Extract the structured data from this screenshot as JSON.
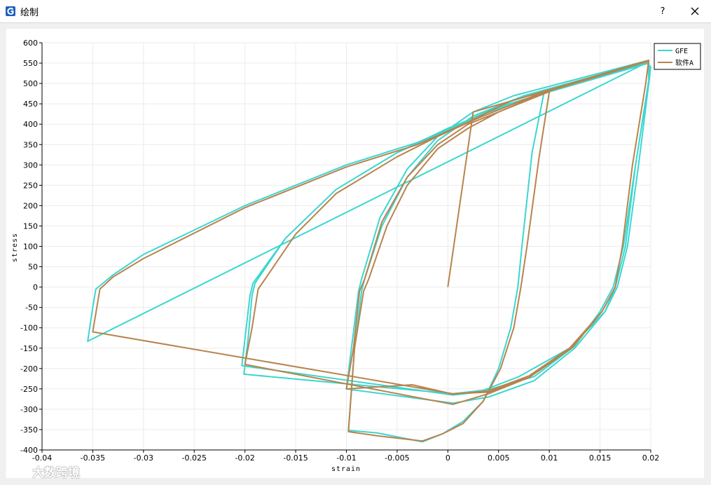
{
  "window": {
    "title": "绘制",
    "help_label": "?",
    "app_icon": "gfe-logo-icon",
    "close_icon": "close-icon"
  },
  "watermark": {
    "text": "大数跨境",
    "icon": "paw-logo-icon"
  },
  "colors": {
    "gfe": "#3cd6d0",
    "software_a": "#b9834d",
    "grid": "#ebebeb"
  },
  "chart_data": {
    "type": "line",
    "xlabel": "strain",
    "ylabel": "stress",
    "xlim": [
      -0.04,
      0.02
    ],
    "ylim": [
      -400,
      600
    ],
    "grid": true,
    "legend_position": "top-right",
    "x_ticks": [
      -0.04,
      -0.035,
      -0.03,
      -0.025,
      -0.02,
      -0.015,
      -0.01,
      -0.005,
      0,
      0.005,
      0.01,
      0.015,
      0.02
    ],
    "y_ticks": [
      600,
      550,
      500,
      450,
      400,
      350,
      300,
      250,
      200,
      150,
      100,
      50,
      0,
      -50,
      -100,
      -150,
      -200,
      -250,
      -300,
      -350,
      -400
    ],
    "x_tick_labels": [
      "-0.04",
      "-0.035",
      "-0.03",
      "-0.025",
      "-0.02",
      "-0.015",
      "-0.01",
      "-0.005",
      "0",
      "0.005",
      "0.01",
      "0.015",
      "0.02"
    ],
    "y_tick_labels": [
      "600",
      "550",
      "500",
      "450",
      "400",
      "350",
      "300",
      "250",
      "200",
      "150",
      "100",
      "50",
      "0",
      "-50",
      "-100",
      "-150",
      "-200",
      "-250",
      "-300",
      "-350",
      "-400"
    ],
    "series": [
      {
        "name": "GFE",
        "color": "#3cd6d0",
        "points": [
          [
            0.0095,
            480
          ],
          [
            0.0083,
            330
          ],
          [
            0.0073,
            100
          ],
          [
            0.0069,
            0
          ],
          [
            0.0062,
            -100
          ],
          [
            0.005,
            -200
          ],
          [
            0.0035,
            -280
          ],
          [
            0.0015,
            -330
          ],
          [
            -0.0005,
            -360
          ],
          [
            -0.0025,
            -380
          ],
          [
            -0.007,
            -358
          ],
          [
            -0.0098,
            -352
          ],
          [
            -0.0092,
            -150
          ],
          [
            -0.0085,
            -10
          ],
          [
            -0.0082,
            20
          ],
          [
            -0.0065,
            150
          ],
          [
            -0.004,
            270
          ],
          [
            -0.001,
            360
          ],
          [
            0.0025,
            420
          ],
          [
            0.007,
            465
          ],
          [
            0.0198,
            550
          ],
          [
            0.0198,
            505
          ],
          [
            0.0185,
            300
          ],
          [
            0.0175,
            100
          ],
          [
            0.0165,
            0
          ],
          [
            0.0155,
            -60
          ],
          [
            0.0125,
            -150
          ],
          [
            0.0085,
            -230
          ],
          [
            0.004,
            -270
          ],
          [
            0.0005,
            -285
          ],
          [
            -0.01,
            -250
          ],
          [
            -0.0095,
            -150
          ],
          [
            -0.0088,
            -10
          ],
          [
            -0.0085,
            20
          ],
          [
            -0.0067,
            170
          ],
          [
            -0.004,
            290
          ],
          [
            -0.001,
            370
          ],
          [
            0.0025,
            430
          ],
          [
            0.0065,
            470
          ],
          [
            0.0195,
            555
          ],
          [
            0.02,
            540
          ],
          [
            0.0185,
            300
          ],
          [
            0.0173,
            100
          ],
          [
            0.0163,
            0
          ],
          [
            0.015,
            -60
          ],
          [
            0.0125,
            -145
          ],
          [
            0.0085,
            -220
          ],
          [
            0.004,
            -252
          ],
          [
            0.0005,
            -262
          ],
          [
            -0.0201,
            -214
          ],
          [
            -0.0197,
            -130
          ],
          [
            -0.0193,
            -20
          ],
          [
            -0.019,
            10
          ],
          [
            -0.016,
            120
          ],
          [
            -0.011,
            240
          ],
          [
            -0.005,
            330
          ],
          [
            -0.001,
            375
          ],
          [
            0.003,
            420
          ],
          [
            0.008,
            465
          ],
          [
            0.0198,
            550
          ],
          [
            0.0199,
            520
          ],
          [
            0.0188,
            300
          ],
          [
            0.0177,
            100
          ],
          [
            0.0167,
            0
          ],
          [
            0.0155,
            -60
          ],
          [
            0.012,
            -150
          ],
          [
            0.007,
            -220
          ],
          [
            0.003,
            -258
          ],
          [
            0.0005,
            -265
          ],
          [
            -0.0203,
            -193
          ],
          [
            -0.0195,
            -20
          ],
          [
            -0.0192,
            10
          ],
          [
            -0.016,
            120
          ],
          [
            -0.011,
            240
          ],
          [
            -0.005,
            330
          ],
          [
            0.0,
            390
          ],
          [
            0.006,
            450
          ],
          [
            0.0195,
            550
          ],
          [
            -0.0355,
            -133
          ],
          [
            -0.035,
            -50
          ],
          [
            -0.0347,
            -5
          ],
          [
            -0.033,
            30
          ],
          [
            -0.03,
            80
          ],
          [
            -0.02,
            200
          ],
          [
            -0.01,
            300
          ],
          [
            -0.003,
            355
          ],
          [
            0.002,
            410
          ],
          [
            0.0075,
            470
          ],
          [
            0.0198,
            555
          ]
        ]
      },
      {
        "name": "软件A",
        "color": "#b9834d",
        "points": [
          [
            0,
            0
          ],
          [
            0.0025,
            430
          ],
          [
            0.0198,
            555
          ],
          [
            0.0195,
            500
          ],
          [
            0.0182,
            300
          ],
          [
            0.0172,
            100
          ],
          [
            0.0165,
            0
          ],
          [
            0.0152,
            -60
          ],
          [
            0.012,
            -150
          ],
          [
            0.008,
            -218
          ],
          [
            0.004,
            -255
          ],
          [
            0.0005,
            -263
          ],
          [
            -0.0035,
            -240
          ],
          [
            -0.01,
            -250
          ],
          [
            -0.0093,
            -150
          ],
          [
            -0.0087,
            -10
          ],
          [
            -0.0082,
            20
          ],
          [
            -0.0065,
            160
          ],
          [
            -0.004,
            270
          ],
          [
            -0.001,
            350
          ],
          [
            0.002,
            400
          ],
          [
            0.006,
            440
          ],
          [
            0.01,
            480
          ],
          [
            0.009,
            320
          ],
          [
            0.0078,
            100
          ],
          [
            0.0072,
            0
          ],
          [
            0.0065,
            -100
          ],
          [
            0.0052,
            -200
          ],
          [
            0.0035,
            -280
          ],
          [
            0.0015,
            -335
          ],
          [
            -0.0005,
            -360
          ],
          [
            -0.0025,
            -378
          ],
          [
            -0.007,
            -365
          ],
          [
            -0.0098,
            -355
          ],
          [
            -0.0092,
            -150
          ],
          [
            -0.0083,
            -10
          ],
          [
            -0.0078,
            20
          ],
          [
            -0.006,
            150
          ],
          [
            -0.004,
            250
          ],
          [
            -0.001,
            340
          ],
          [
            0.002,
            390
          ],
          [
            0.005,
            430
          ],
          [
            0.0095,
            478
          ],
          [
            0.0198,
            555
          ],
          [
            0.0195,
            500
          ],
          [
            0.0182,
            300
          ],
          [
            0.0172,
            100
          ],
          [
            0.0165,
            0
          ],
          [
            0.0152,
            -60
          ],
          [
            0.0122,
            -150
          ],
          [
            0.008,
            -222
          ],
          [
            0.004,
            -262
          ],
          [
            0.0005,
            -288
          ],
          [
            -0.02,
            -190
          ],
          [
            -0.0193,
            -100
          ],
          [
            -0.0187,
            -5
          ],
          [
            -0.018,
            20
          ],
          [
            -0.015,
            130
          ],
          [
            -0.011,
            230
          ],
          [
            -0.005,
            320
          ],
          [
            -0.001,
            370
          ],
          [
            0.003,
            415
          ],
          [
            0.0085,
            470
          ],
          [
            0.0198,
            557
          ],
          [
            0.0195,
            500
          ],
          [
            0.0182,
            300
          ],
          [
            0.0172,
            100
          ],
          [
            0.0165,
            0
          ],
          [
            0.0152,
            -60
          ],
          [
            0.0122,
            -150
          ],
          [
            0.008,
            -222
          ],
          [
            0.004,
            -258
          ],
          [
            0.0005,
            -262
          ],
          [
            -0.035,
            -110
          ],
          [
            -0.0343,
            -5
          ],
          [
            -0.033,
            25
          ],
          [
            -0.03,
            70
          ],
          [
            -0.02,
            195
          ],
          [
            -0.01,
            295
          ],
          [
            -0.003,
            350
          ],
          [
            0.002,
            405
          ],
          [
            0.006,
            455
          ],
          [
            0.0198,
            557
          ]
        ]
      }
    ]
  }
}
